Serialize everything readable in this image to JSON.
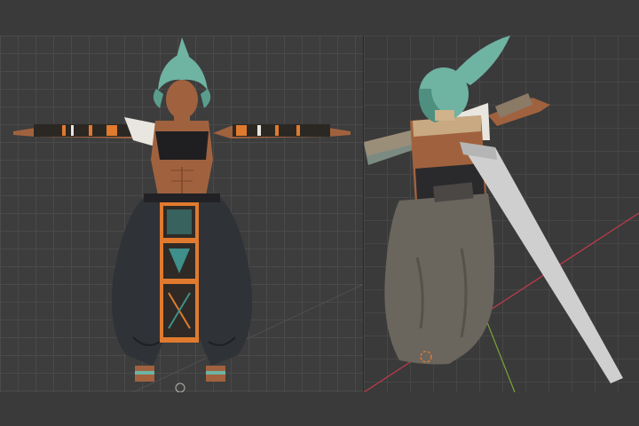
{
  "window": {
    "title": ""
  },
  "viewports": {
    "front": {
      "view": "front-orthographic"
    },
    "perspective": {
      "view": "user-perspective"
    }
  },
  "colors": {
    "background": "#3d3d3d",
    "grid_line": "#4a4a4a",
    "x_axis": "#c03a4a",
    "y_axis": "#7ea23a",
    "skin": "#a0623e",
    "hair": "#6fb3a2",
    "pants": "#2f3236",
    "pattern_orange": "#e07a2e",
    "pattern_teal": "#3f8f8a",
    "cloth_white": "#e9e6e0",
    "sword": "#cfcfcf"
  },
  "icons": [
    "origin-point-icon"
  ]
}
